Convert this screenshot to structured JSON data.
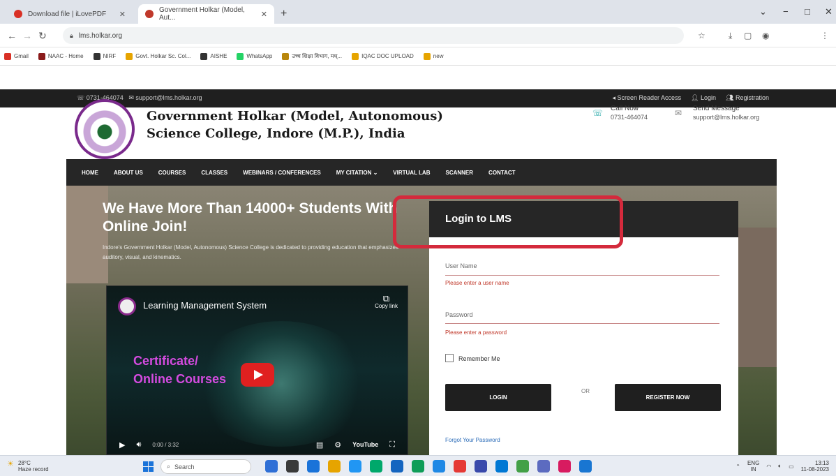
{
  "browser": {
    "tabs": [
      {
        "label": "Download file | iLovePDF",
        "active": false
      },
      {
        "label": "Government Holkar (Model, Aut...",
        "active": true
      }
    ],
    "new_tab": "+",
    "url": "lms.holkar.org",
    "window_controls": {
      "minimize": "−",
      "maximize": "□",
      "close": "✕"
    }
  },
  "bookmarks": [
    {
      "label": "Gmail",
      "color": "#d93025"
    },
    {
      "label": "NAAC - Home",
      "color": "#8a1a1a"
    },
    {
      "label": "NIRF",
      "color": "#333333"
    },
    {
      "label": "Govt. Holkar Sc. Col...",
      "color": "#e6a400"
    },
    {
      "label": "AISHE",
      "color": "#333333"
    },
    {
      "label": "WhatsApp",
      "color": "#25d366"
    },
    {
      "label": "उच्च शिक्षा विभाग, मध्...",
      "color": "#b8860b"
    },
    {
      "label": "IQAC DOC UPLOAD",
      "color": "#e6a400"
    },
    {
      "label": "new",
      "color": "#e6a400"
    }
  ],
  "top_strip": {
    "phone": "0731-464074",
    "email": "support@lms.holkar.org",
    "screen_reader": "Screen Reader Access",
    "login": "Login",
    "registration": "Registration"
  },
  "site": {
    "title_line1": "Government Holkar (Model, Autonomous)",
    "title_line2": "Science College, Indore (M.P.), India",
    "call_label": "Call Now",
    "call_value": "0731-464074",
    "message_label": "Send Message",
    "message_value": "support@lms.holkar.org"
  },
  "nav": [
    "HOME",
    "ABOUT US",
    "COURSES",
    "CLASSES",
    "WEBINARS / CONFERENCES",
    "MY CITATION ⌄",
    "VIRTUAL LAB",
    "SCANNER",
    "CONTACT"
  ],
  "hero": {
    "title_line1": "We Have More Than 14000+ Students With",
    "title_line2": "Online Join!",
    "subtitle": "Indore's Government Holkar (Model, Autonomous) Science College is dedicated to providing education that emphasizes auditory, visual, and kinematics."
  },
  "video": {
    "title": "Learning Management System",
    "copy_link": "Copy link",
    "overlay_line1": "Certificate/",
    "overlay_line2": "Online Courses",
    "time": "0:00 / 3:32",
    "youtube": "YouTube"
  },
  "login": {
    "heading": "Login to LMS",
    "username_label": "User Name",
    "username_error": "Please enter a user name",
    "password_label": "Password",
    "password_error": "Please enter a password",
    "remember": "Remember Me",
    "login_button": "LOGIN",
    "or": "OR",
    "register_button": "REGISTER NOW",
    "forgot": "Forgot Your Password"
  },
  "taskbar": {
    "temp": "28°C",
    "weather": "Haze record",
    "search": "Search",
    "lang": "ENG",
    "region": "IN",
    "time": "13:13",
    "date": "11-08-2023"
  },
  "colors": {
    "highlight": "#d42a3c",
    "dark": "#262626",
    "accent_purple": "#d44be0"
  }
}
